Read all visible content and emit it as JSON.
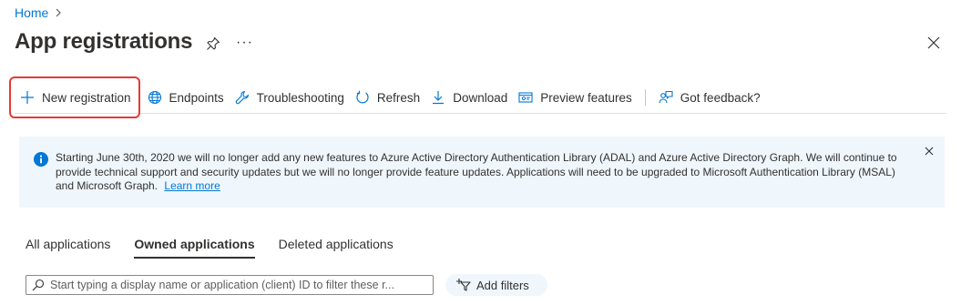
{
  "breadcrumb": {
    "home": "Home"
  },
  "page": {
    "title": "App registrations"
  },
  "header": {
    "more_label": "···"
  },
  "toolbar": {
    "new_registration": "New registration",
    "endpoints": "Endpoints",
    "troubleshooting": "Troubleshooting",
    "refresh": "Refresh",
    "download": "Download",
    "preview_features": "Preview features",
    "feedback": "Got feedback?"
  },
  "banner": {
    "message": "Starting June 30th, 2020 we will no longer add any new features to Azure Active Directory Authentication Library (ADAL) and Azure Active Directory Graph. We will continue to provide technical support and security updates but we will no longer provide feature updates. Applications will need to be upgraded to Microsoft Authentication Library (MSAL) and Microsoft Graph.",
    "link": "Learn more"
  },
  "tabs": [
    {
      "label": "All applications",
      "active": false
    },
    {
      "label": "Owned applications",
      "active": true
    },
    {
      "label": "Deleted applications",
      "active": false
    }
  ],
  "search": {
    "placeholder": "Start typing a display name or application (client) ID to filter these r..."
  },
  "filters": {
    "add_label": "Add filters"
  },
  "colors": {
    "accent": "#0078d4",
    "banner_bg": "#eff6fc",
    "highlight": "#e53935"
  }
}
